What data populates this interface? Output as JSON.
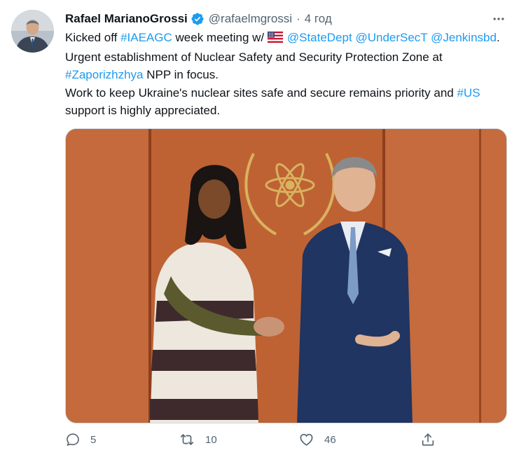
{
  "tweet": {
    "author_name": "Rafael MarianoGrossi",
    "handle": "@rafaelmgrossi",
    "separator": "·",
    "time": "4 год",
    "text": {
      "seg1": "Kicked off ",
      "tag_iaeagc": "#IAEAGC",
      "seg2": " week meeting w/ ",
      "mention_statedept": "@StateDept",
      "mention_undersect": "@UnderSecT",
      "mention_jenkins": "@Jenkinsbd",
      "seg3": ". Urgent establishment of Nuclear Safety and Security Protection Zone at ",
      "tag_zaporizhzhya": "#Zaporizhzhya",
      "seg4": " NPP in focus.",
      "seg5": "Work to keep Ukraine's nuclear sites safe and secure remains priority and ",
      "tag_us": "#US",
      "seg6": " support is highly appreciated."
    },
    "stats": {
      "replies": "5",
      "retweets": "10",
      "likes": "46"
    }
  },
  "colors": {
    "link": "#1d9bf0",
    "muted": "#536471",
    "verified": "#1d9bf0",
    "text": "#0f1419"
  },
  "icons": [
    "verified-badge-icon",
    "more-icon",
    "us-flag-icon",
    "reply-icon",
    "retweet-icon",
    "like-icon",
    "share-icon"
  ]
}
